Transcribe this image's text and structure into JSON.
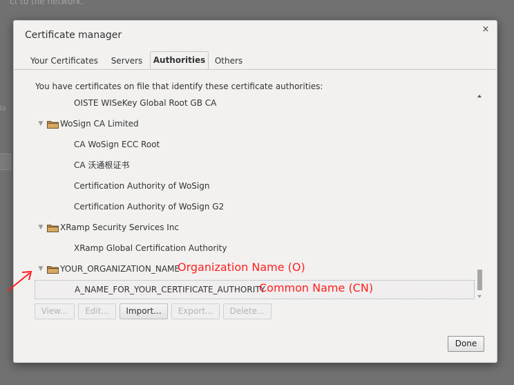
{
  "background": {
    "top_text": "ct to the network.",
    "left_fragment": "lan"
  },
  "dialog": {
    "title": "Certificate manager",
    "close_glyph": "×"
  },
  "tabs": [
    {
      "label": "Your Certificates",
      "active": false
    },
    {
      "label": "Servers",
      "active": false
    },
    {
      "label": "Authorities",
      "active": true
    },
    {
      "label": "Others",
      "active": false
    }
  ],
  "intro_text": "You have certificates on file that identify these certificate authorities:",
  "tree": [
    {
      "label": "OISTE WISeKey Global Root GB CA",
      "type": "cert"
    },
    {
      "label": "WoSign CA Limited",
      "type": "org",
      "expanded": true
    },
    {
      "label": "CA WoSign ECC Root",
      "type": "cert"
    },
    {
      "label": "CA 沃通根证书",
      "type": "cert"
    },
    {
      "label": "Certification Authority of WoSign",
      "type": "cert"
    },
    {
      "label": "Certification Authority of WoSign G2",
      "type": "cert"
    },
    {
      "label": "XRamp Security Services Inc",
      "type": "org",
      "expanded": true
    },
    {
      "label": "XRamp Global Certification Authority",
      "type": "cert"
    },
    {
      "label": "YOUR_ORGANIZATION_NAME",
      "type": "org",
      "expanded": true
    },
    {
      "label": "A_NAME_FOR_YOUR_CERTIFICATE_AUTHORITY",
      "type": "cert",
      "selected": true
    }
  ],
  "buttons": {
    "view": "View...",
    "edit": "Edit...",
    "import": "Import...",
    "export": "Export...",
    "delete": "Delete...",
    "done": "Done"
  },
  "annotations": {
    "org": "Organization Name (O)",
    "cn": "Common Name (CN)"
  },
  "icons": {
    "folder": "folder-icon",
    "expander": "triangle-down-icon",
    "close": "close-icon"
  },
  "colors": {
    "annotation": "#ff1e1e",
    "dialog_bg": "#f2f1f0",
    "backdrop": "#717171"
  }
}
